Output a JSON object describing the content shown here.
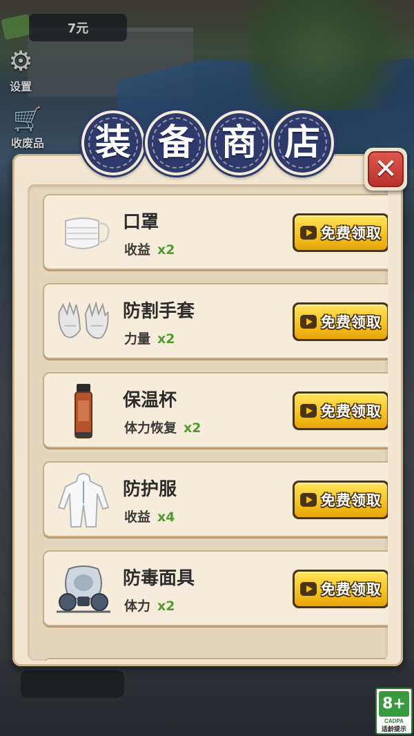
{
  "hud": {
    "money": "7元",
    "settings_label": "设置",
    "recycle_label": "收废品"
  },
  "shop": {
    "title_chars": [
      "装",
      "备",
      "商",
      "店"
    ],
    "close_symbol": "✕",
    "items": [
      {
        "name": "口罩",
        "stat": "收益",
        "multiplier": "x2",
        "icon": "face-mask-icon",
        "button_label": "免费领取"
      },
      {
        "name": "防割手套",
        "stat": "力量",
        "multiplier": "x2",
        "icon": "gloves-icon",
        "button_label": "免费领取"
      },
      {
        "name": "保温杯",
        "stat": "体力恢复",
        "multiplier": "x2",
        "icon": "thermos-icon",
        "button_label": "免费领取"
      },
      {
        "name": "防护服",
        "stat": "收益",
        "multiplier": "x4",
        "icon": "protective-suit-icon",
        "button_label": "免费领取"
      },
      {
        "name": "防毒面具",
        "stat": "体力",
        "multiplier": "x2",
        "icon": "gas-mask-icon",
        "button_label": "免费领取"
      }
    ]
  },
  "rating": {
    "age": "8+",
    "org": "CADPA",
    "tip": "适龄提示"
  },
  "colors": {
    "title_disc": "#2d3a6b",
    "button_yellow": "#f6c21a",
    "multiplier_green": "#4f9b2f",
    "close_red": "#d0463d"
  }
}
